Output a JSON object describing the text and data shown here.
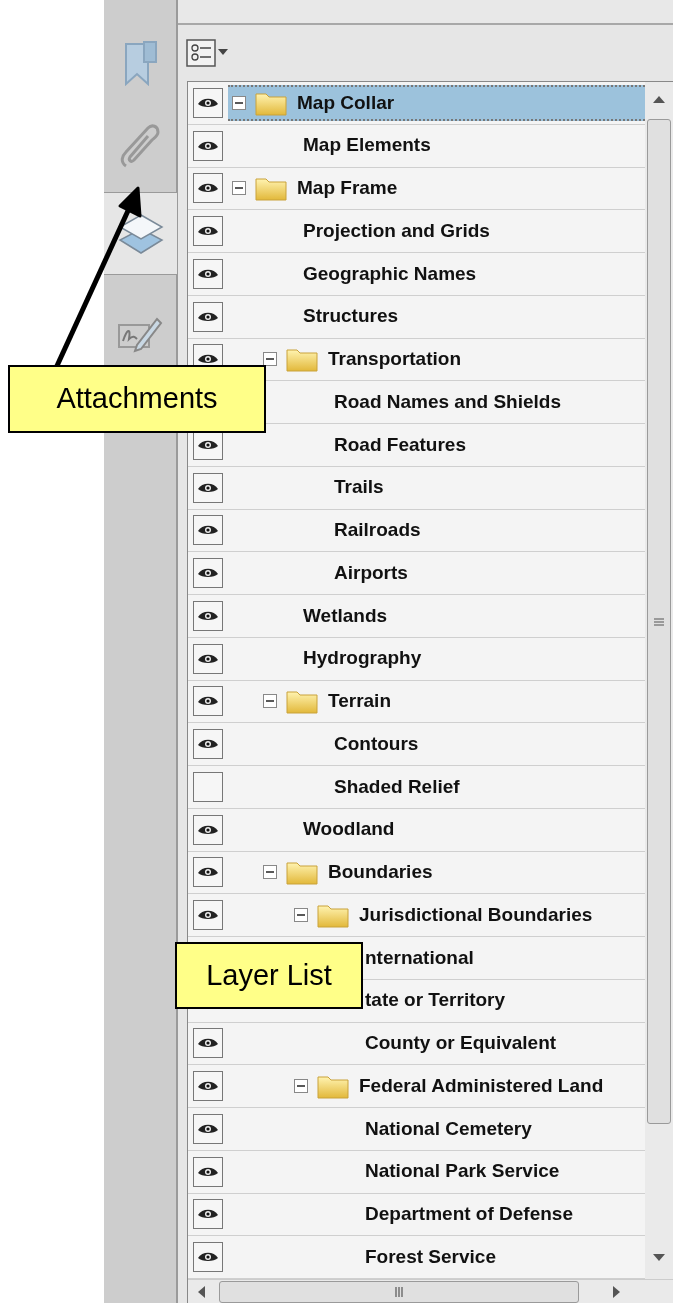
{
  "sidebar": {
    "tabs": [
      {
        "kind": "bookmarks",
        "selected": false
      },
      {
        "kind": "attachments",
        "selected": false
      },
      {
        "kind": "layers",
        "selected": true
      },
      {
        "kind": "signatures",
        "selected": false
      }
    ]
  },
  "layers": [
    {
      "name": "Map Collar",
      "visible": true,
      "selected": true,
      "expanded": true,
      "children": [
        {
          "name": "Map Elements",
          "visible": true,
          "selected": false
        }
      ]
    },
    {
      "name": "Map Frame",
      "visible": true,
      "selected": false,
      "expanded": true,
      "children": [
        {
          "name": "Projection and Grids",
          "visible": true,
          "selected": false
        },
        {
          "name": "Geographic Names",
          "visible": true,
          "selected": false
        },
        {
          "name": "Structures",
          "visible": true,
          "selected": false
        },
        {
          "name": "Transportation",
          "visible": true,
          "selected": false,
          "expanded": true,
          "children": [
            {
              "name": "Road Names and Shields",
              "selected": false
            },
            {
              "name": "Road Features",
              "visible": true,
              "selected": false
            },
            {
              "name": "Trails",
              "visible": true,
              "selected": false
            },
            {
              "name": "Railroads",
              "visible": true,
              "selected": false
            },
            {
              "name": "Airports",
              "visible": true,
              "selected": false
            }
          ]
        },
        {
          "name": "Wetlands",
          "visible": true,
          "selected": false
        },
        {
          "name": "Hydrography",
          "visible": true,
          "selected": false
        },
        {
          "name": "Terrain",
          "visible": true,
          "selected": false,
          "expanded": true,
          "children": [
            {
              "name": "Contours",
              "visible": true,
              "selected": false
            },
            {
              "name": "Shaded Relief",
              "visible": false,
              "selected": false
            }
          ]
        },
        {
          "name": "Woodland",
          "visible": true,
          "selected": false
        },
        {
          "name": "Boundaries",
          "visible": true,
          "selected": false,
          "expanded": true,
          "children": [
            {
              "name": "Jurisdictional Boundaries",
              "visible": true,
              "selected": false,
              "expanded": true,
              "children": [
                {
                  "name": "nternational",
                  "selected": false
                },
                {
                  "name": "tate or Territory",
                  "selected": false
                },
                {
                  "name": "County or Equivalent",
                  "visible": true,
                  "selected": false
                }
              ]
            },
            {
              "name": "Federal Administered Land",
              "visible": true,
              "selected": false,
              "expanded": true,
              "children": [
                {
                  "name": "National Cemetery",
                  "visible": true,
                  "selected": false
                },
                {
                  "name": "National Park Service",
                  "visible": true,
                  "selected": false
                },
                {
                  "name": "Department of Defense",
                  "visible": true,
                  "selected": false
                },
                {
                  "name": "Forest Service",
                  "visible": true,
                  "selected": false
                }
              ]
            }
          ]
        }
      ]
    }
  ],
  "callouts": [
    {
      "kind": "arrow",
      "text": "Attachments"
    },
    {
      "kind": "plain",
      "text": "Layer List"
    }
  ]
}
